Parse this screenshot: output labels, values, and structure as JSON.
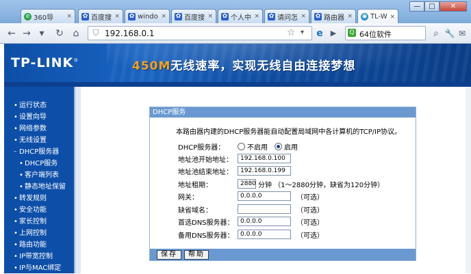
{
  "browser": {
    "tabs": [
      {
        "label": "360导",
        "favicon": "360-icon",
        "icon_text": "e"
      },
      {
        "label": "百度搜",
        "favicon": "baidu-paw-icon",
        "icon_text": "🐾"
      },
      {
        "label": "windo",
        "favicon": "baidu-paw-icon",
        "icon_text": "🐾"
      },
      {
        "label": "百度搜",
        "favicon": "baidu-paw-icon",
        "icon_text": "🐾"
      },
      {
        "label": "个人中",
        "favicon": "baidu-paw-icon",
        "icon_text": "🐾"
      },
      {
        "label": "请问怎",
        "favicon": "baidu-paw-icon",
        "icon_text": "🐾"
      },
      {
        "label": "路由器",
        "favicon": "baidu-paw-icon",
        "icon_text": "🐾"
      },
      {
        "label": "TL-W",
        "favicon": "globe-icon",
        "icon_text": "◉"
      }
    ],
    "close_glyph": "×",
    "window_controls": {
      "minimize": "—",
      "maximize": "□",
      "close": "✕"
    },
    "nav": {
      "back": "←",
      "forward": "→",
      "reload": "↻",
      "home": "⌂",
      "dropdown": "▾",
      "star": "☆",
      "ie": "e",
      "play": "▶",
      "shield": "⛉",
      "extra1": "✂",
      "extra2": "✉",
      "extra3": "🔧"
    },
    "url": "192.168.0.1",
    "search_engine_icon": "Q",
    "search_text": "64位软件"
  },
  "router": {
    "brand": "TP-LINK",
    "brand_mark": "®",
    "slogan_accent": "450M",
    "slogan_rest": "无线速率，实现无线自由连接梦想",
    "menu": [
      {
        "label": "运行状态",
        "bullet": "•"
      },
      {
        "label": "设置向导",
        "bullet": "•"
      },
      {
        "label": "网络参数",
        "bullet": "•"
      },
      {
        "label": "无线设置",
        "bullet": "•"
      },
      {
        "label": "DHCP服务器",
        "bullet": "–"
      },
      {
        "label": "DHCP服务",
        "bullet": "•"
      },
      {
        "label": "客户端列表",
        "bullet": "•"
      },
      {
        "label": "静态地址保留",
        "bullet": "•"
      },
      {
        "label": "转发规则",
        "bullet": "•"
      },
      {
        "label": "安全功能",
        "bullet": "•"
      },
      {
        "label": "家长控制",
        "bullet": "•"
      },
      {
        "label": "上网控制",
        "bullet": "•"
      },
      {
        "label": "路由功能",
        "bullet": "•"
      },
      {
        "label": "IP带宽控制",
        "bullet": "•"
      },
      {
        "label": "IP与MAC绑定",
        "bullet": "•"
      }
    ],
    "panel": {
      "title": "DHCP服务",
      "intro": "本路由器内建的DHCP服务器能自动配置局域网中各计算机的TCP/IP协议。",
      "dhcp_label": "DHCP服务器：",
      "disable_label": "不启用",
      "enable_label": "启用",
      "enabled": true,
      "start_label": "地址池开始地址：",
      "start_value": "192.168.0.100",
      "end_label": "地址池结束地址：",
      "end_value": "192.168.0.199",
      "lease_label": "地址租期：",
      "lease_value": "2880",
      "lease_hint": "分钟 （1～2880分钟，缺省为120分钟）",
      "gateway_label": "网关：",
      "gateway_value": "0.0.0.0",
      "domain_label": "缺省域名：",
      "domain_value": "",
      "dns1_label": "首选DNS服务器：",
      "dns1_value": "0.0.0.0",
      "dns2_label": "备用DNS服务器：",
      "dns2_value": "0.0.0.0",
      "optional": "（可选）",
      "save": "保存",
      "help": "帮助"
    }
  }
}
